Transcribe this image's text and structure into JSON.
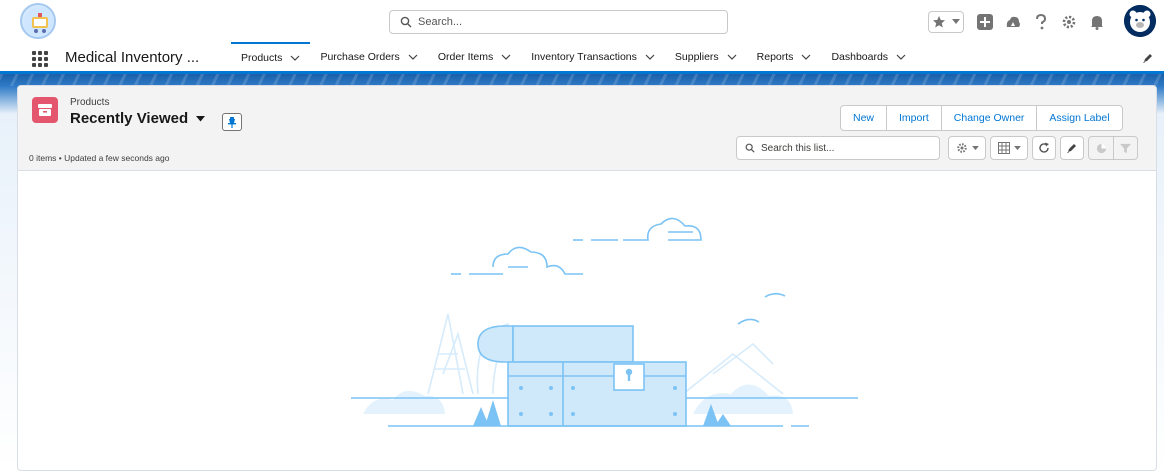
{
  "global_header": {
    "search_placeholder": "Search..."
  },
  "nav": {
    "app_name": "Medical Inventory ...",
    "items": [
      {
        "label": "Products",
        "active": true
      },
      {
        "label": "Purchase Orders",
        "active": false
      },
      {
        "label": "Order Items",
        "active": false
      },
      {
        "label": "Inventory Transactions",
        "active": false
      },
      {
        "label": "Suppliers",
        "active": false
      },
      {
        "label": "Reports",
        "active": false
      },
      {
        "label": "Dashboards",
        "active": false
      }
    ]
  },
  "list_view": {
    "object_label": "Products",
    "title": "Recently Viewed",
    "meta": "0 items • Updated a few seconds ago",
    "actions": [
      "New",
      "Import",
      "Change Owner",
      "Assign Label"
    ],
    "search_placeholder": "Search this list..."
  },
  "colors": {
    "brand_blue": "#0176d3",
    "object_icon": "#e3566e",
    "illustration_line": "#7cc3f5",
    "illustration_fill": "#cfe9fb"
  }
}
